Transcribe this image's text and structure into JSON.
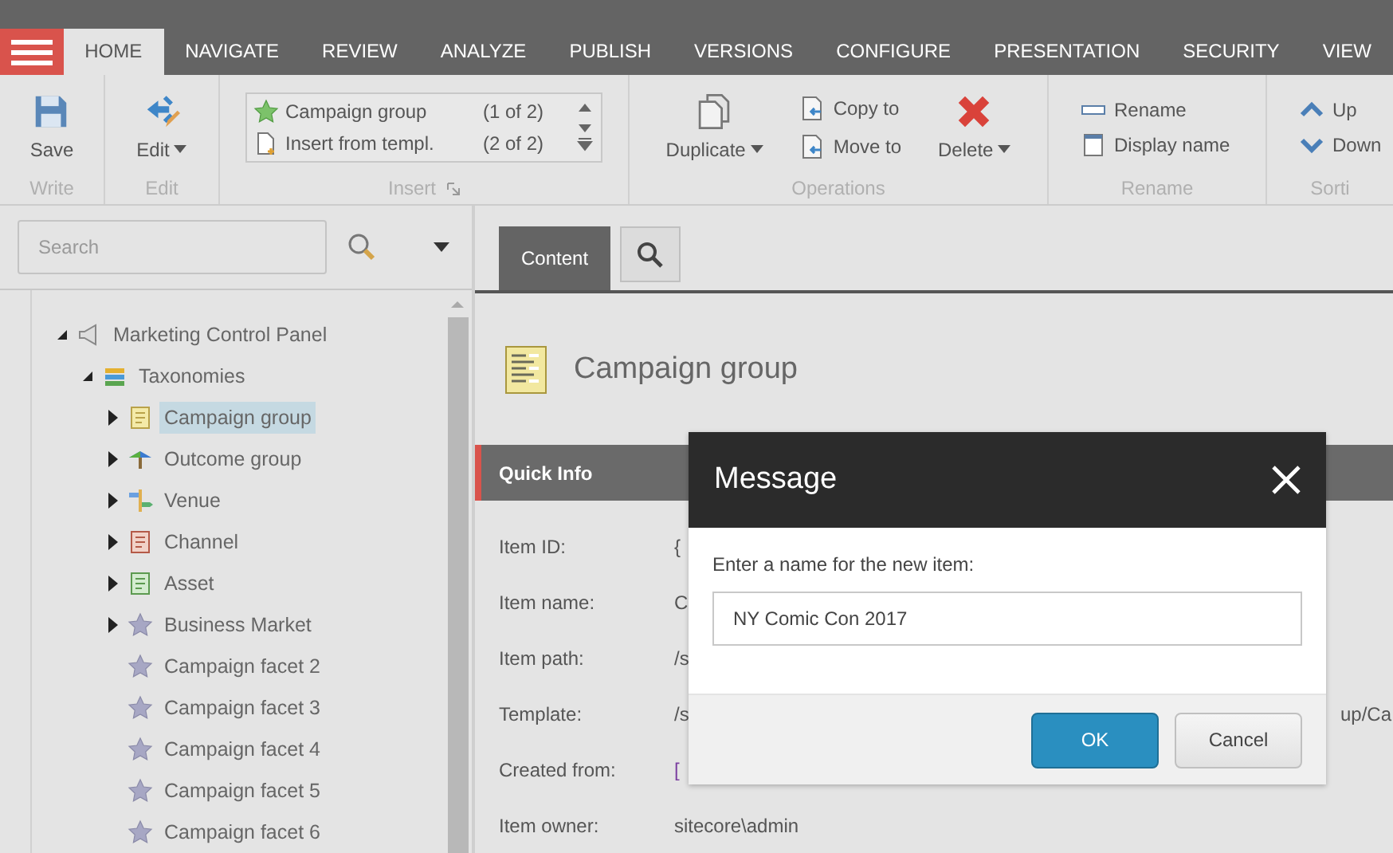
{
  "menu_tabs": [
    {
      "label": "HOME",
      "selected": true
    },
    {
      "label": "NAVIGATE",
      "selected": false
    },
    {
      "label": "REVIEW",
      "selected": false
    },
    {
      "label": "ANALYZE",
      "selected": false
    },
    {
      "label": "PUBLISH",
      "selected": false
    },
    {
      "label": "VERSIONS",
      "selected": false
    },
    {
      "label": "CONFIGURE",
      "selected": false
    },
    {
      "label": "PRESENTATION",
      "selected": false
    },
    {
      "label": "SECURITY",
      "selected": false
    },
    {
      "label": "VIEW",
      "selected": false
    }
  ],
  "ribbon": [
    {
      "kind": "big",
      "label": "Write",
      "buttons": [
        {
          "label": "Save",
          "dropdown": false
        }
      ]
    },
    {
      "kind": "big",
      "label": "Edit",
      "buttons": [
        {
          "label": "Edit",
          "dropdown": true
        }
      ]
    },
    {
      "kind": "gallery",
      "label": "Insert",
      "options": [
        {
          "label": "Campaign group",
          "count": "(1 of 2)"
        },
        {
          "label": "Insert from templ.",
          "count": "(2 of 2)"
        }
      ]
    },
    {
      "kind": "mixed",
      "label": "Operations",
      "buttons": [
        {
          "label": "Duplicate",
          "dropdown": true
        },
        {
          "label": "Copy to",
          "dropdown": false
        },
        {
          "label": "Move to",
          "dropdown": false
        },
        {
          "label": "Delete",
          "dropdown": true
        }
      ]
    },
    {
      "kind": "small",
      "label": "Rename",
      "buttons": [
        {
          "label": "Rename",
          "dropdown": false
        },
        {
          "label": "Display name",
          "dropdown": false
        }
      ]
    },
    {
      "kind": "small",
      "label": "Sorti",
      "buttons": [
        {
          "label": "Up",
          "dropdown": false
        },
        {
          "label": "Down",
          "dropdown": false
        }
      ]
    }
  ],
  "search": {
    "placeholder": "Search"
  },
  "tree": [
    {
      "label": "Marketing Control Panel",
      "expanded": true,
      "selected": false,
      "children": [
        {
          "label": "Taxonomies",
          "expanded": true,
          "selected": false,
          "children": [
            {
              "label": "Campaign group",
              "expanded": false,
              "selected": true
            },
            {
              "label": "Outcome group",
              "expanded": false,
              "selected": false
            },
            {
              "label": "Venue",
              "expanded": false,
              "selected": false
            },
            {
              "label": "Channel",
              "expanded": false,
              "selected": false
            },
            {
              "label": "Asset",
              "expanded": false,
              "selected": false
            },
            {
              "label": "Business Market",
              "expanded": false,
              "selected": false
            },
            {
              "label": "Campaign facet 2",
              "selected": false
            },
            {
              "label": "Campaign facet 3",
              "selected": false
            },
            {
              "label": "Campaign facet 4",
              "selected": false
            },
            {
              "label": "Campaign facet 5",
              "selected": false
            },
            {
              "label": "Campaign facet 6",
              "selected": false
            }
          ]
        }
      ]
    }
  ],
  "editor_tabs": [
    {
      "kind": "text",
      "label": "Content",
      "selected": true
    },
    {
      "kind": "search",
      "selected": false
    }
  ],
  "item_title": "Campaign group",
  "quick_info": {
    "title": "Quick Info",
    "rows": [
      {
        "label": "Item ID:",
        "value": "{"
      },
      {
        "label": "Item name:",
        "value": "C"
      },
      {
        "label": "Item path:",
        "value": "/s"
      },
      {
        "label": "Template:",
        "value": "/s",
        "value_tail": "up/Ca"
      },
      {
        "label": "Created from:",
        "value": "[",
        "link": true
      },
      {
        "label": "Item owner:",
        "value": "sitecore\\admin"
      }
    ]
  },
  "dialog": {
    "title": "Message",
    "prompt": "Enter a name for the new item:",
    "value": "NY Comic Con 2017",
    "buttons": [
      {
        "label": "OK",
        "primary": true
      },
      {
        "label": "Cancel",
        "primary": false
      }
    ]
  }
}
